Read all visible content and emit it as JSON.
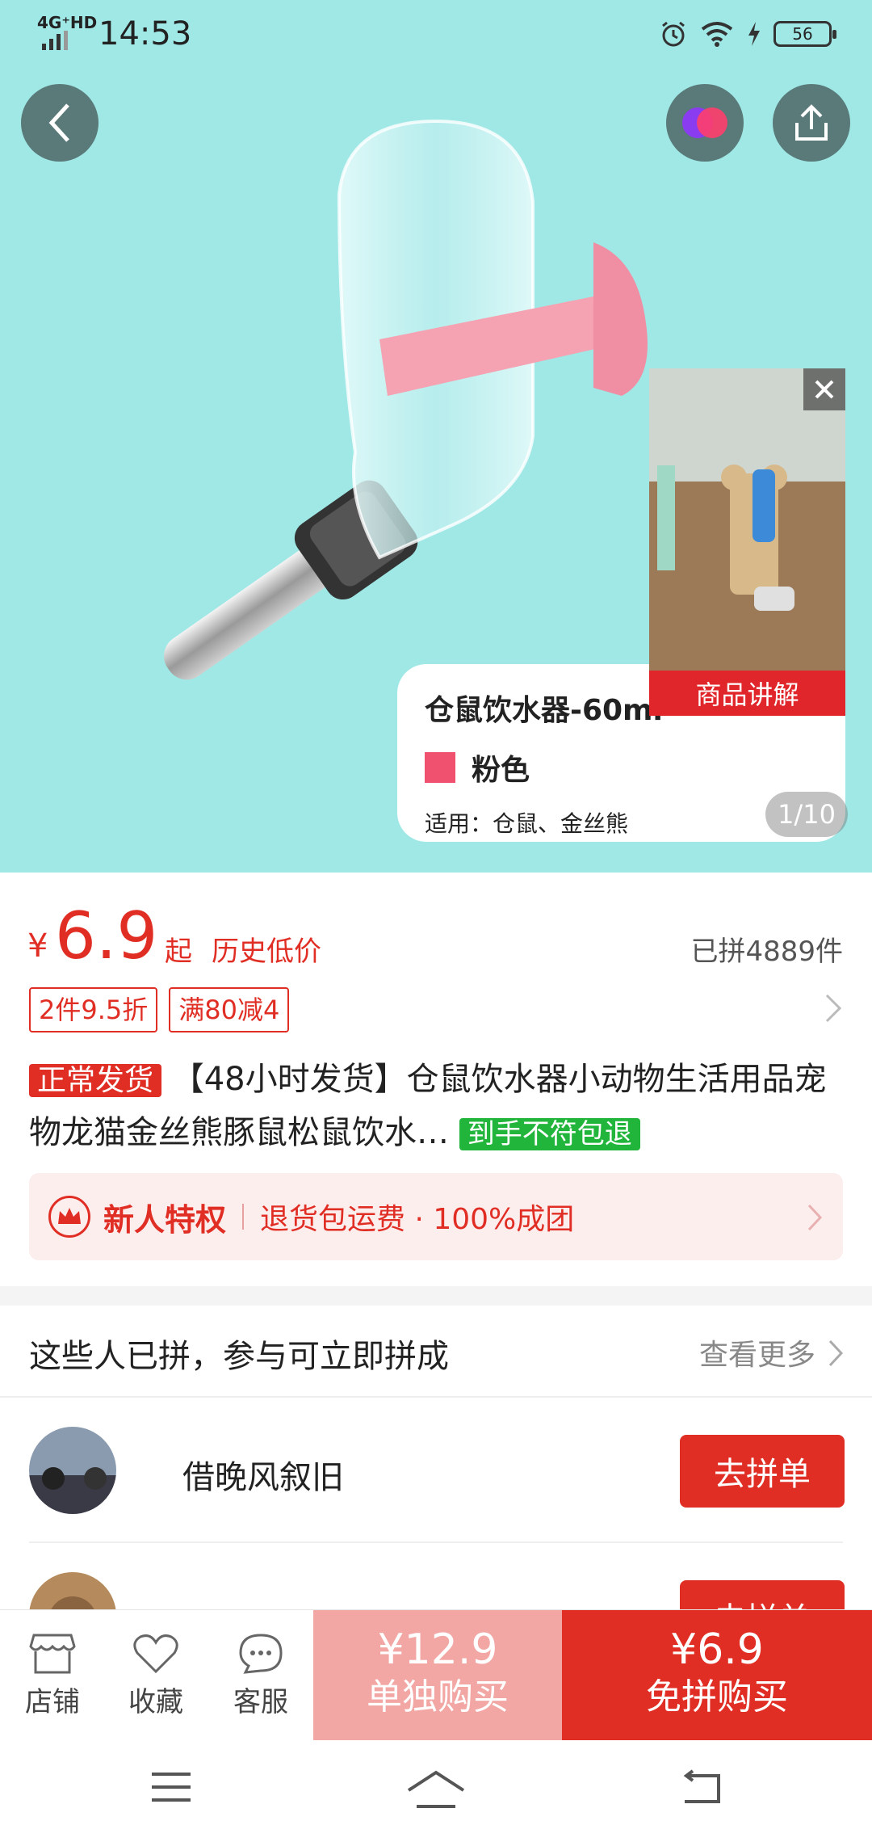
{
  "status_bar": {
    "network": "4G⁺HD",
    "time": "14:53",
    "battery": "56"
  },
  "hero": {
    "caption": {
      "title": "仓鼠饮水器-60ml",
      "color_name": "粉色",
      "usage": "适用：仓鼠、金丝熊"
    },
    "page_indicator": "1/10",
    "video_popup": {
      "label": "商品讲解"
    },
    "colors": {
      "background": "#9fe8e6",
      "swatch": "#f0516e"
    }
  },
  "price": {
    "currency": "¥",
    "value": "6.9",
    "suffix": "起",
    "note": "历史低价",
    "sold": "已拼4889件"
  },
  "promo_tags": [
    "2件9.5折",
    "满80减4"
  ],
  "product": {
    "badge": "正常发货",
    "title": "【48小时发货】仓鼠饮水器小动物生活用品宠物龙猫金丝熊豚鼠松鼠饮水…",
    "guarantee": "到手不符包退"
  },
  "new_user": {
    "title": "新人特权",
    "desc": "退货包运费 · 100%成团"
  },
  "group_buy": {
    "header": "这些人已拼，参与可立即拼成",
    "more": "查看更多",
    "rows": [
      {
        "name": "借晚风叙旧",
        "button": "去拼单"
      },
      {
        "name": "ₔ",
        "button": "去拼单"
      }
    ]
  },
  "bottom_bar": {
    "store": "店铺",
    "favorite": "收藏",
    "service": "客服",
    "buy_alone_price": "¥12.9",
    "buy_alone_label": "单独购买",
    "buy_group_price": "¥6.9",
    "buy_group_label": "免拼购买"
  },
  "accent_color": "#e02e24"
}
